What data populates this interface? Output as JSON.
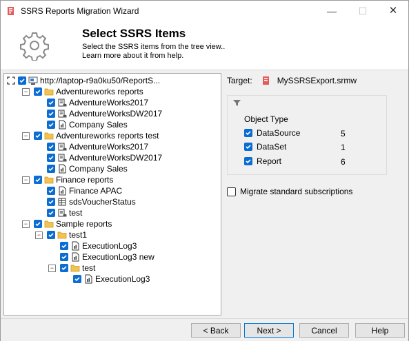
{
  "window": {
    "title": "SSRS Reports Migration Wizard"
  },
  "header": {
    "title": "Select SSRS Items",
    "subtitle_line1": "Select the SSRS items from the tree view..",
    "subtitle_line2": "Learn more about it from help."
  },
  "tree": {
    "root": "http://laptop-r9a0ku50/ReportS...",
    "items": [
      {
        "label": "Adventureworks reports",
        "type": "folder"
      },
      {
        "label": "AdventureWorks2017",
        "type": "datasource"
      },
      {
        "label": "AdventureWorksDW2017",
        "type": "datasource"
      },
      {
        "label": "Company Sales",
        "type": "report"
      },
      {
        "label": "Adventureworks reports test",
        "type": "folder"
      },
      {
        "label": "AdventureWorks2017",
        "type": "datasource"
      },
      {
        "label": "AdventureWorksDW2017",
        "type": "datasource"
      },
      {
        "label": "Company Sales",
        "type": "report"
      },
      {
        "label": "Finance reports",
        "type": "folder"
      },
      {
        "label": "Finance APAC",
        "type": "report"
      },
      {
        "label": "sdsVoucherStatus",
        "type": "dataset"
      },
      {
        "label": "test",
        "type": "datasource"
      },
      {
        "label": "Sample reports",
        "type": "folder"
      },
      {
        "label": "test1",
        "type": "folder"
      },
      {
        "label": "ExecutionLog3",
        "type": "report"
      },
      {
        "label": "ExecutionLog3 new",
        "type": "report"
      },
      {
        "label": "test",
        "type": "folder"
      },
      {
        "label": "ExecutionLog3",
        "type": "report"
      }
    ]
  },
  "target": {
    "label": "Target:",
    "file": "MySSRSExport.srmw"
  },
  "filter": {
    "heading": "Object Type",
    "rows": [
      {
        "label": "DataSource",
        "count": "5"
      },
      {
        "label": "DataSet",
        "count": "1"
      },
      {
        "label": "Report",
        "count": "6"
      }
    ]
  },
  "subscriptions_label": "Migrate standard subscriptions",
  "footer": {
    "back": "< Back",
    "next": "Next >",
    "cancel": "Cancel",
    "help": "Help"
  },
  "colors": {
    "accent": "#0b6dd1",
    "folder": "#f2c34e"
  }
}
